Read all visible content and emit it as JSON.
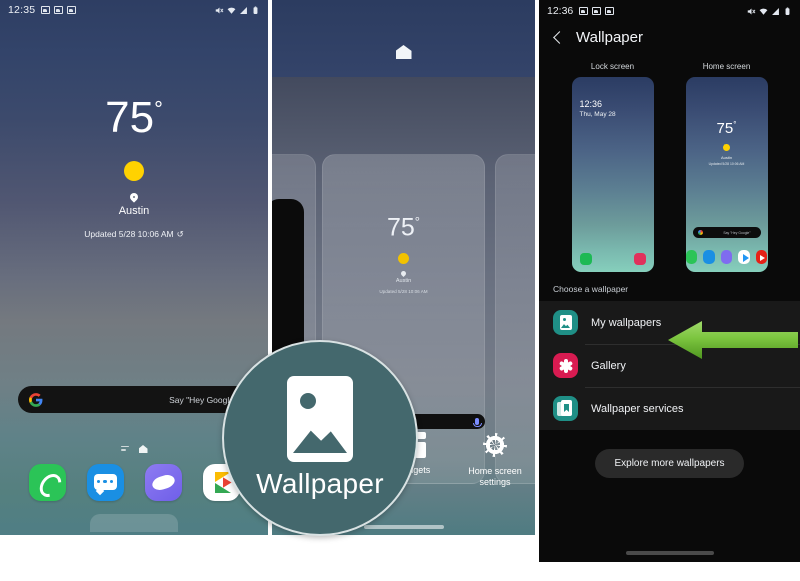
{
  "panel_home": {
    "status_bar": {
      "time": "12:35",
      "left_icons": [
        "image-icon",
        "email-icon",
        "app-icon"
      ],
      "right_icons": [
        "mute-icon",
        "wifi-icon",
        "signal-icon",
        "battery-icon"
      ]
    },
    "weather": {
      "temperature": "75",
      "degree_symbol": "°",
      "condition_icon": "sun-icon",
      "location": "Austin",
      "updated": "Updated 5/28 10:06 AM",
      "refresh_icon": "↺"
    },
    "search_bar": {
      "logo": "google-logo",
      "hint": "Say \"Hey Google\""
    },
    "dock_apps": [
      {
        "name": "Phone",
        "icon": "phone-icon"
      },
      {
        "name": "Messages",
        "icon": "messages-icon"
      },
      {
        "name": "Internet",
        "icon": "internet-icon"
      },
      {
        "name": "Play Store",
        "icon": "play-store-icon"
      }
    ]
  },
  "panel_edit": {
    "home_glyph": "home-icon",
    "weather": {
      "temperature": "75",
      "degree_symbol": "°",
      "location": "Austin",
      "updated": "Updated 5/28 10:06 AM"
    },
    "search_hint": "",
    "toolbar": [
      {
        "label": "Widgets",
        "icon": "widgets-icon"
      },
      {
        "label": "Home screen\nsettings",
        "label_line1": "Home screen",
        "label_line2": "settings",
        "icon": "gear-icon"
      }
    ]
  },
  "panel_wallpaper": {
    "status_bar": {
      "time": "12:36",
      "right_icons": [
        "mute-icon",
        "wifi-icon",
        "signal-icon",
        "battery-icon"
      ]
    },
    "back_icon": "chevron-left-icon",
    "title": "Wallpaper",
    "previews": [
      {
        "label": "Lock screen",
        "clock": "12:36",
        "date": "Thu, May 28"
      },
      {
        "label": "Home screen",
        "temperature": "75",
        "degree_symbol": "°",
        "location": "Austin",
        "updated": "Updated 5/28 10:06 AM",
        "search_hint": "Say \"Hey Google\""
      }
    ],
    "section_label": "Choose a wallpaper",
    "options": [
      {
        "label": "My wallpapers",
        "icon": "my-wallpapers-icon",
        "icon_color": "#1f8f86",
        "highlighted": true
      },
      {
        "label": "Gallery",
        "icon": "gallery-icon",
        "icon_color": "#d81b51",
        "highlighted": false
      },
      {
        "label": "Wallpaper services",
        "icon": "wallpaper-services-icon",
        "icon_color": "#1f8f86",
        "highlighted": false
      }
    ],
    "explore_button": "Explore more wallpapers"
  },
  "callout": {
    "label": "Wallpaper",
    "icon": "picture-icon",
    "background_color": "#44686d",
    "border_color": "#d9e2e3"
  },
  "annotation_arrow": {
    "direction": "left",
    "color": "#76c043",
    "target": "My wallpapers"
  }
}
